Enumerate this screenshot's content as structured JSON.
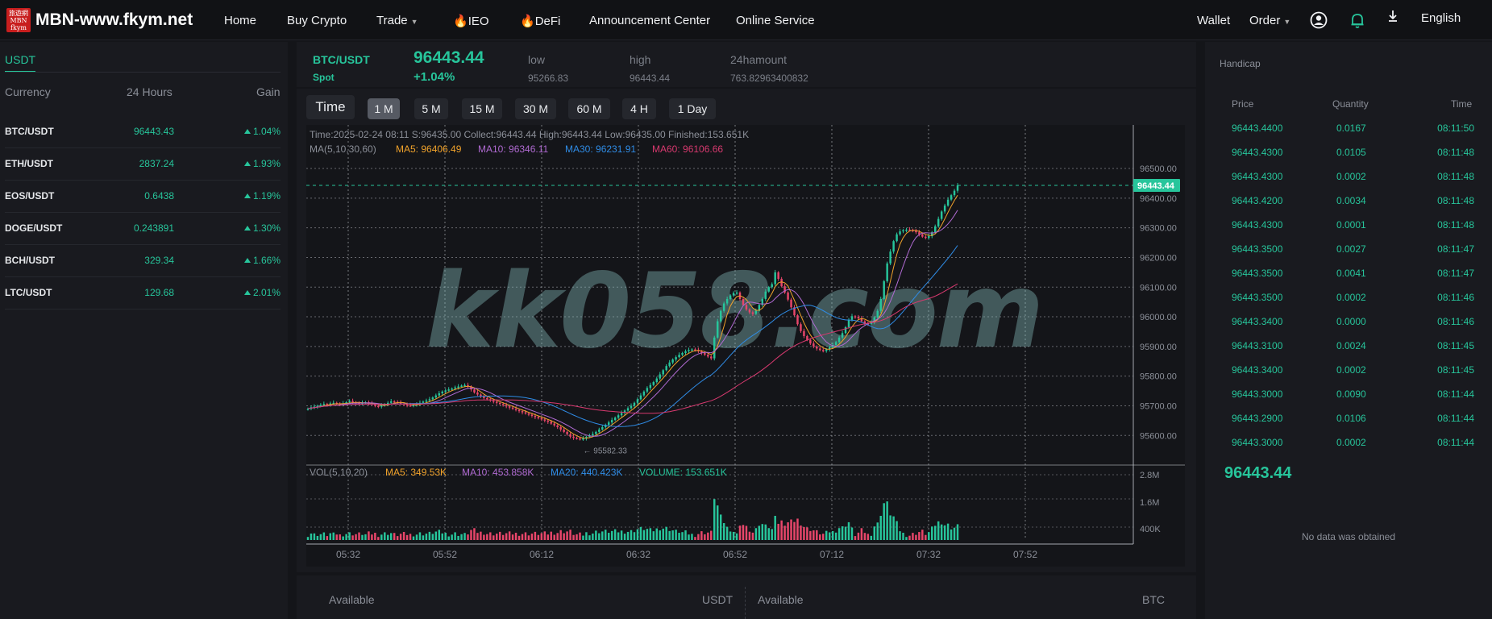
{
  "header": {
    "logo_glyph": "旅遊網 MBN fkym",
    "site_name": "MBN-www.fkym.net",
    "nav": [
      "Home",
      "Buy Crypto",
      "Trade",
      "IEO",
      "DeFi",
      "Announcement Center",
      "Online Service"
    ],
    "wallet": "Wallet",
    "order": "Order",
    "language": "English"
  },
  "markets": {
    "tab": "USDT",
    "columns": [
      "Currency",
      "24 Hours",
      "Gain"
    ],
    "rows": [
      {
        "symbol": "BTC/USDT",
        "price": "96443.43",
        "gain": "1.04%"
      },
      {
        "symbol": "ETH/USDT",
        "price": "2837.24",
        "gain": "1.93%"
      },
      {
        "symbol": "EOS/USDT",
        "price": "0.6438",
        "gain": "1.19%"
      },
      {
        "symbol": "DOGE/USDT",
        "price": "0.243891",
        "gain": "1.30%"
      },
      {
        "symbol": "BCH/USDT",
        "price": "329.34",
        "gain": "1.66%"
      },
      {
        "symbol": "LTC/USDT",
        "price": "129.68",
        "gain": "2.01%"
      }
    ]
  },
  "ticker": {
    "pair": "BTC/USDT",
    "type": "Spot",
    "price": "96443.44",
    "change": "+1.04%",
    "low_label": "low",
    "low": "95266.83",
    "high_label": "high",
    "high": "96443.44",
    "amount_label": "24hamount",
    "amount": "763.82963400832"
  },
  "timeframes": [
    "Time",
    "1 M",
    "5 M",
    "15 M",
    "30 M",
    "60 M",
    "4 H",
    "1 Day"
  ],
  "chart_info": {
    "ohlc": "Time:2025-02-24 08:11   S:96435.00   Collect:96443.44   High:96443.44   Low:96435.00   Finished:153.651K",
    "ma_label": "MA(5,10,30,60)",
    "ma5": "MA5: 96406.49",
    "ma10": "MA10: 96346.11",
    "ma30": "MA30: 96231.91",
    "ma60": "MA60: 96106.66",
    "vol_label": "VOL(5,10,20)",
    "vma5": "MA5: 349.53K",
    "vma10": "MA10: 453.858K",
    "vma20": "MA20: 440.423K",
    "volume": "VOLUME: 153.651K",
    "low_marker": "95582.33",
    "last_price_tag": "96443.44",
    "watermark": "kk058.com"
  },
  "colors": {
    "up": "#27c59b",
    "down": "#e8466a",
    "ma5": "#f0a22b",
    "ma10": "#b06ad2",
    "ma30": "#2f8ce6",
    "ma60": "#d8396f"
  },
  "chart_data": {
    "type": "candlestick",
    "x_ticks": [
      "05:32",
      "05:52",
      "06:12",
      "06:32",
      "06:52",
      "07:12",
      "07:32",
      "07:52"
    ],
    "y_ticks": [
      "96500.00",
      "96400.00",
      "96300.00",
      "96200.00",
      "96100.00",
      "96000.00",
      "95900.00",
      "95800.00",
      "95700.00",
      "95600.00"
    ],
    "ylim": [
      95560,
      96530
    ],
    "volume_ticks": [
      "2.8M",
      "1.6M",
      "400K"
    ],
    "volume_max": 3000,
    "close": [
      95690,
      95695,
      95697,
      95700,
      95703,
      95706,
      95704,
      95708,
      95710,
      95706,
      95705,
      95708,
      95712,
      95716,
      95712,
      95709,
      95706,
      95710,
      95712,
      95708,
      95704,
      95700,
      95698,
      95701,
      95705,
      95710,
      95715,
      95713,
      95711,
      95708,
      95705,
      95702,
      95700,
      95703,
      95706,
      95710,
      95714,
      95718,
      95722,
      95728,
      95735,
      95742,
      95748,
      95752,
      95755,
      95758,
      95762,
      95765,
      95768,
      95770,
      95765,
      95755,
      95745,
      95738,
      95732,
      95726,
      95722,
      95718,
      95714,
      95710,
      95706,
      95702,
      95698,
      95694,
      95690,
      95686,
      95682,
      95678,
      95674,
      95670,
      95666,
      95662,
      95658,
      95654,
      95650,
      95646,
      95640,
      95634,
      95628,
      95620,
      95612,
      95604,
      95596,
      95592,
      95590,
      95588,
      95590,
      95595,
      95600,
      95605,
      95612,
      95620,
      95628,
      95636,
      95644,
      95652,
      95660,
      95668,
      95676,
      95684,
      95692,
      95700,
      95710,
      95722,
      95735,
      95748,
      95760,
      95770,
      95780,
      95792,
      95806,
      95820,
      95834,
      95846,
      95856,
      95864,
      95872,
      95878,
      95884,
      95888,
      95890,
      95888,
      95884,
      95878,
      95872,
      95866,
      95860,
      95930,
      95985,
      96020,
      96045,
      96060,
      96072,
      96080,
      96082,
      96060,
      96040,
      96025,
      96015,
      96010,
      96020,
      96040,
      96060,
      96085,
      96100,
      96110,
      96150,
      96128,
      96103,
      96082,
      96058,
      96032,
      96005,
      95975,
      95952,
      95935,
      95922,
      95910,
      95900,
      95893,
      95888,
      95885,
      95890,
      95898,
      95905,
      95915,
      95930,
      95945,
      95965,
      95990,
      96002,
      96000,
      95995,
      95985,
      95978,
      95976,
      95980,
      95998,
      96020,
      96060,
      96120,
      96180,
      96220,
      96255,
      96278,
      96288,
      96292,
      96294,
      96293,
      96290,
      96285,
      96278,
      96270,
      96266,
      96272,
      96285,
      96305,
      96330,
      96355,
      96375,
      96395,
      96410,
      96425,
      96443
    ]
  },
  "order_form": {
    "available_left": "Available",
    "currency_left": "USDT",
    "available_right": "Available",
    "currency_right": "BTC"
  },
  "handicap": {
    "title": "Handicap",
    "columns": [
      "Price",
      "Quantity",
      "Time"
    ],
    "trades": [
      {
        "price": "96443.4400",
        "qty": "0.0167",
        "time": "08:11:50"
      },
      {
        "price": "96443.4300",
        "qty": "0.0105",
        "time": "08:11:48"
      },
      {
        "price": "96443.4300",
        "qty": "0.0002",
        "time": "08:11:48"
      },
      {
        "price": "96443.4200",
        "qty": "0.0034",
        "time": "08:11:48"
      },
      {
        "price": "96443.4300",
        "qty": "0.0001",
        "time": "08:11:48"
      },
      {
        "price": "96443.3500",
        "qty": "0.0027",
        "time": "08:11:47"
      },
      {
        "price": "96443.3500",
        "qty": "0.0041",
        "time": "08:11:47"
      },
      {
        "price": "96443.3500",
        "qty": "0.0002",
        "time": "08:11:46"
      },
      {
        "price": "96443.3400",
        "qty": "0.0000",
        "time": "08:11:46"
      },
      {
        "price": "96443.3100",
        "qty": "0.0024",
        "time": "08:11:45"
      },
      {
        "price": "96443.3400",
        "qty": "0.0002",
        "time": "08:11:45"
      },
      {
        "price": "96443.3000",
        "qty": "0.0090",
        "time": "08:11:44"
      },
      {
        "price": "96443.2900",
        "qty": "0.0106",
        "time": "08:11:44"
      },
      {
        "price": "96443.3000",
        "qty": "0.0002",
        "time": "08:11:44"
      }
    ],
    "last_price": "96443.44",
    "empty": "No data was obtained"
  }
}
